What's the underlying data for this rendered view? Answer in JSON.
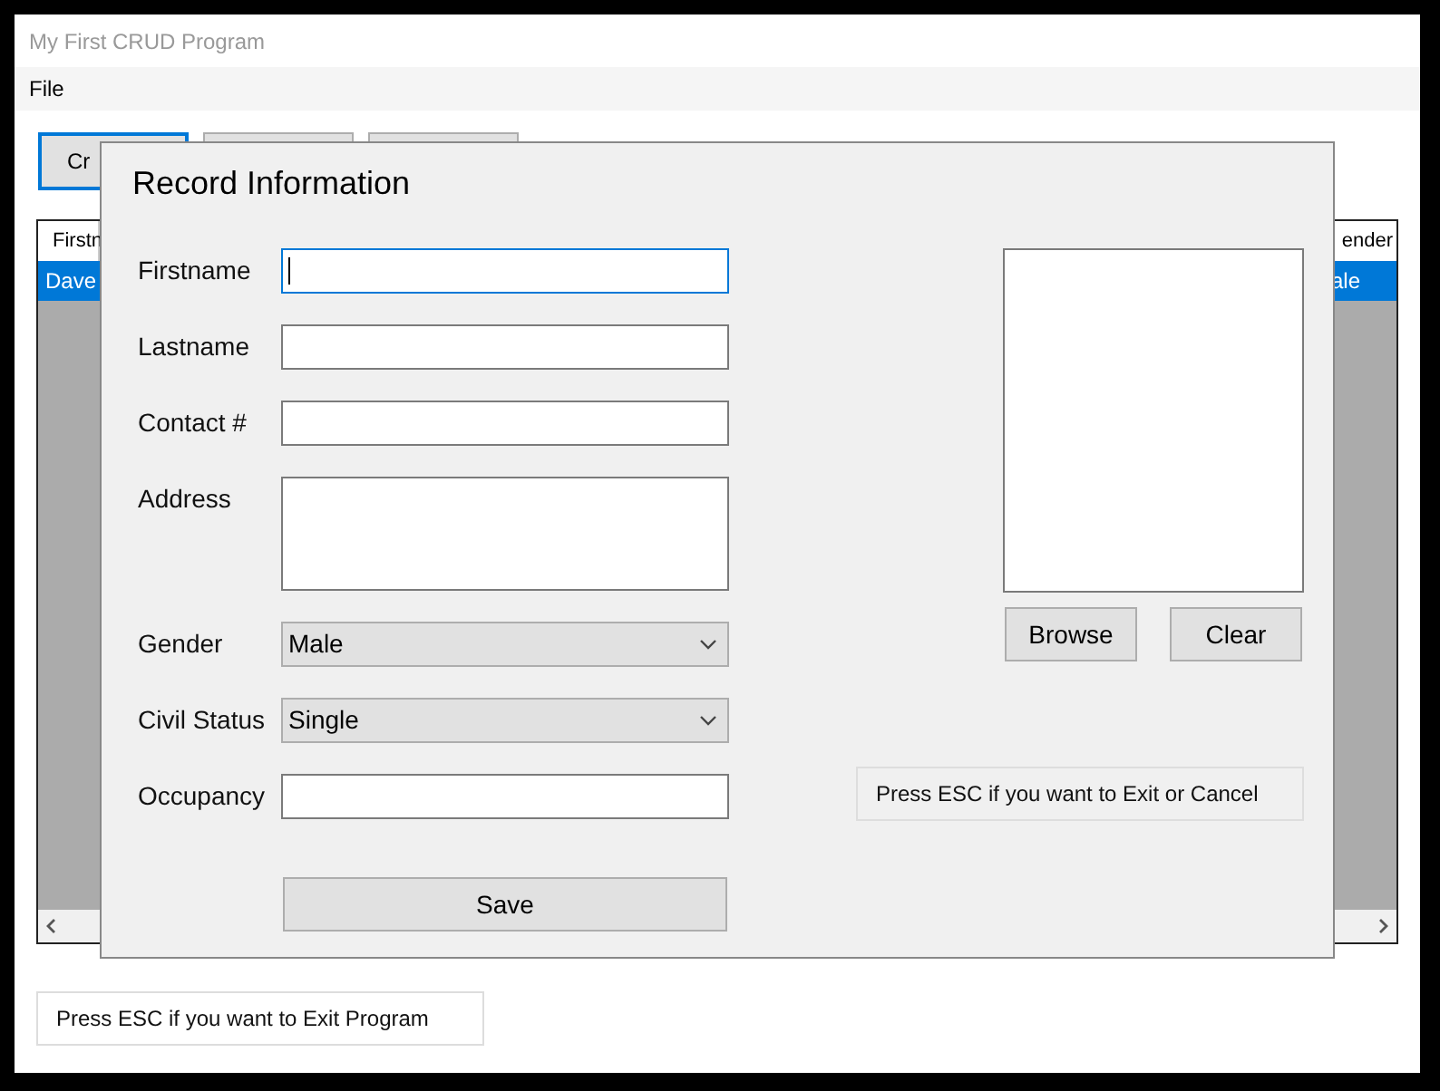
{
  "window": {
    "title": "My First CRUD Program"
  },
  "menu": [
    "File"
  ],
  "toolbar": [
    {
      "label": "Cr",
      "focused": true
    },
    {
      "focused": false
    },
    {
      "focused": false
    }
  ],
  "grid": {
    "columns": [
      "Firstn",
      "ender"
    ],
    "rows": [
      {
        "cells": [
          "Dave",
          "ale"
        ],
        "selected": true
      }
    ]
  },
  "exit_hint": "Press ESC if you want to Exit Program",
  "dialog": {
    "title": "Record Information",
    "fields": [
      {
        "label": "Firstname",
        "kind": "text",
        "focused": true
      },
      {
        "label": "Lastname",
        "kind": "text",
        "focused": false
      },
      {
        "label": "Contact #",
        "kind": "text",
        "focused": false
      },
      {
        "label": "Address",
        "kind": "textarea",
        "focused": false
      },
      {
        "label": "Gender",
        "kind": "select",
        "value": "Male"
      },
      {
        "label": "Civil Status",
        "kind": "select",
        "value": "Single"
      },
      {
        "label": "Occupancy",
        "kind": "text",
        "focused": false
      }
    ],
    "save": "Save",
    "photo_buttons": [
      "Browse",
      "Clear"
    ],
    "hint": "Press ESC if you want to Exit or Cancel"
  }
}
